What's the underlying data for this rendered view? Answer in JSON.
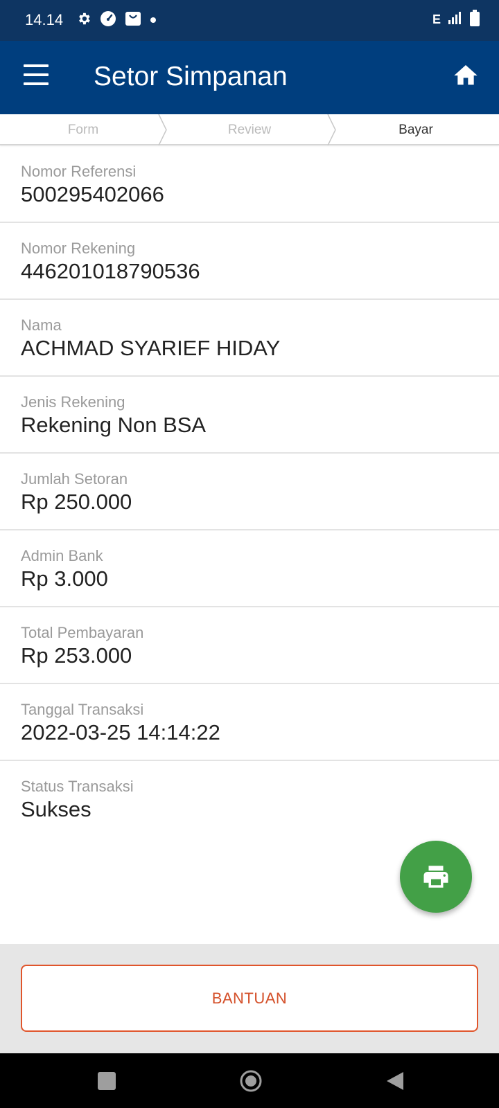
{
  "status_bar": {
    "time": "14.14",
    "network": "E",
    "icons": [
      "gear-icon",
      "speedometer-icon",
      "shopping-bag-icon",
      "dot-icon",
      "signal-icon",
      "battery-icon"
    ]
  },
  "app_bar": {
    "title": "Setor Simpanan",
    "icons": [
      "menu-icon",
      "home-icon"
    ]
  },
  "stepper": {
    "steps": [
      {
        "label": "Form",
        "state": "done"
      },
      {
        "label": "Review",
        "state": "done"
      },
      {
        "label": "Bayar",
        "state": "active"
      }
    ]
  },
  "details": [
    {
      "label": "Nomor Referensi",
      "value": "500295402066"
    },
    {
      "label": "Nomor Rekening",
      "value": "446201018790536"
    },
    {
      "label": "Nama",
      "value": "ACHMAD SYARIEF HIDAY"
    },
    {
      "label": "Jenis Rekening",
      "value": "Rekening Non BSA"
    },
    {
      "label": "Jumlah Setoran",
      "value": "Rp 250.000"
    },
    {
      "label": "Admin Bank",
      "value": "Rp 3.000"
    },
    {
      "label": "Total Pembayaran",
      "value": "Rp 253.000"
    },
    {
      "label": "Tanggal Transaksi",
      "value": "2022-03-25 14:14:22"
    },
    {
      "label": "Status Transaksi",
      "value": "Sukses"
    }
  ],
  "fab": {
    "icon": "printer-icon"
  },
  "help_button": {
    "label": "BANTUAN"
  },
  "colors": {
    "status_bar": "#0e3562",
    "app_bar": "#003e7e",
    "fab": "#43a047",
    "help_accent": "#e0552b",
    "bottom_area": "#e6e6e6"
  }
}
